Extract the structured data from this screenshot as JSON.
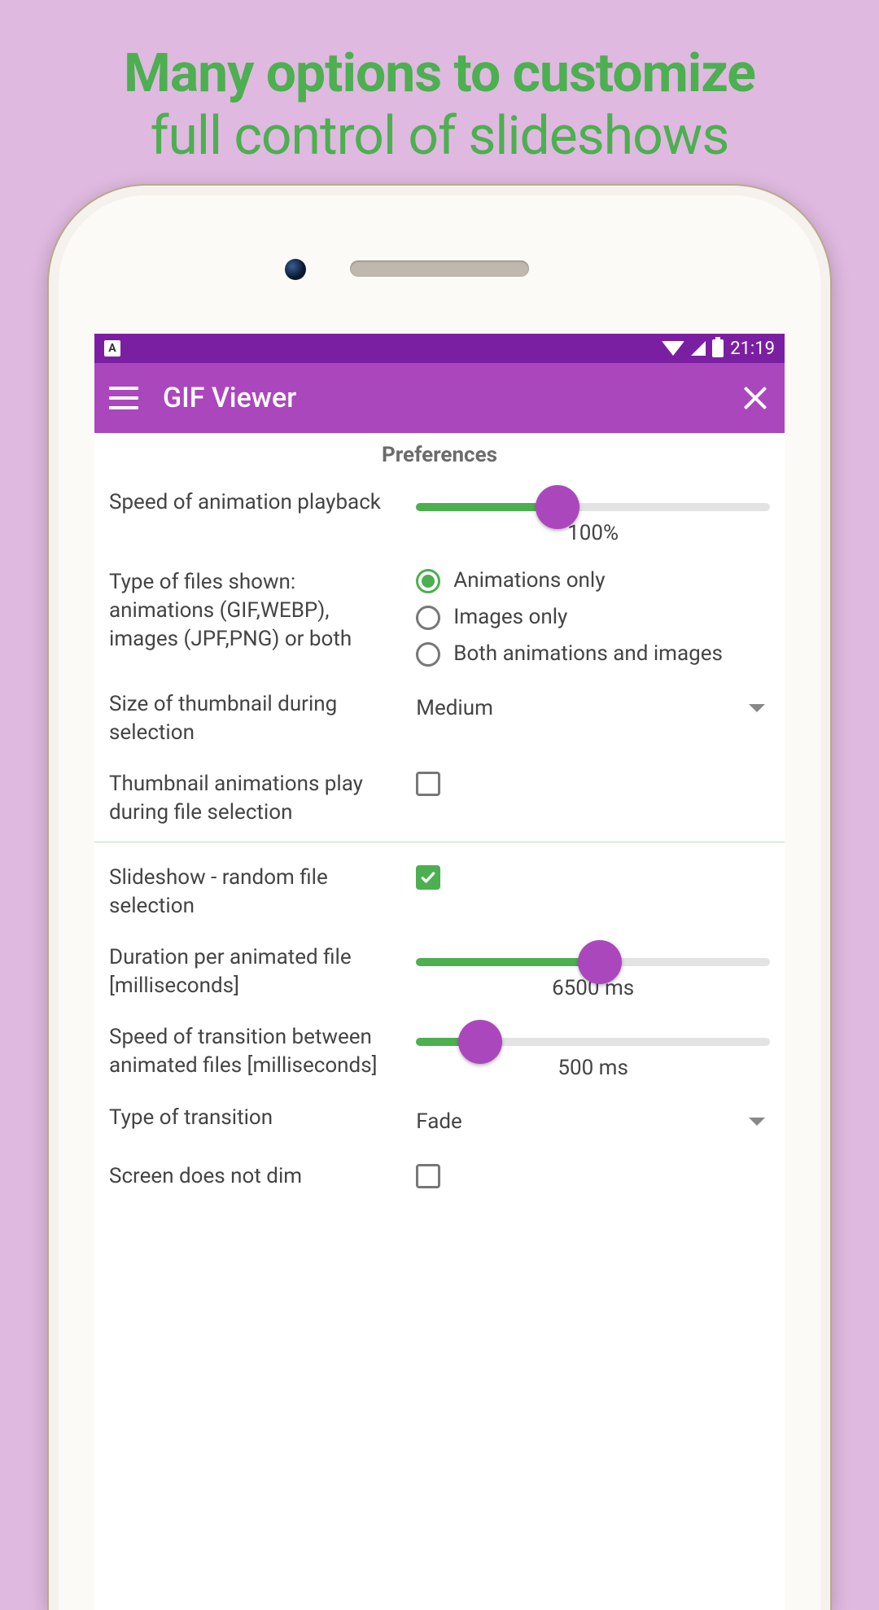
{
  "promo": {
    "line1": "Many options to customize",
    "line2": "full control of slideshows"
  },
  "statusbar": {
    "time": "21:19"
  },
  "appbar": {
    "title": "GIF Viewer"
  },
  "prefs": {
    "heading": "Preferences",
    "speed": {
      "label": "Speed of animation playback",
      "percent": 40,
      "value_text": "100%"
    },
    "filetypes": {
      "label": "Type of files shown: animations (GIF,WEBP), images (JPF,PNG) or both",
      "options": [
        {
          "label": "Animations only",
          "checked": true
        },
        {
          "label": "Images only",
          "checked": false
        },
        {
          "label": "Both animations and images",
          "checked": false
        }
      ]
    },
    "thumbsize": {
      "label": "Size of thumbnail during selection",
      "value": "Medium"
    },
    "thumbanim": {
      "label": "Thumbnail animations play during file selection",
      "checked": false
    },
    "random": {
      "label": "Slideshow - random file selection",
      "checked": true
    },
    "duration": {
      "label": "Duration per animated file [milliseconds]",
      "percent": 52,
      "value_text": "6500 ms"
    },
    "transition_speed": {
      "label": "Speed of transition between animated files [milliseconds]",
      "percent": 18,
      "value_text": "500 ms"
    },
    "transition_type": {
      "label": "Type of transition",
      "value": "Fade"
    },
    "nodim": {
      "label": "Screen does not dim",
      "checked": false
    }
  }
}
